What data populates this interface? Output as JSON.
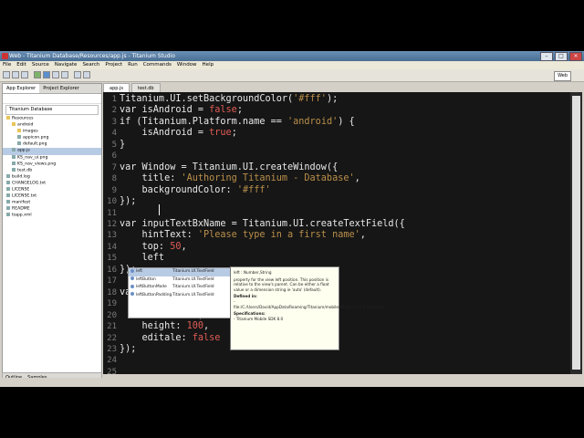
{
  "window": {
    "title": "Web - Titanium Database/Resources/app.js - Titanium Studio",
    "controls": [
      "–",
      "□",
      "×"
    ]
  },
  "menu": [
    "File",
    "Edit",
    "Source",
    "Navigate",
    "Search",
    "Project",
    "Run",
    "Commands",
    "Window",
    "Help"
  ],
  "toolbar": {
    "perspective_label": "Web"
  },
  "left_panel": {
    "tabs": [
      "App Explorer",
      "Project Explorer"
    ],
    "project": "Titanium Database",
    "tree": [
      {
        "label": "Resources",
        "level": 0,
        "folder": true
      },
      {
        "label": "android",
        "level": 1,
        "folder": true
      },
      {
        "label": "images",
        "level": 2,
        "folder": true
      },
      {
        "label": "appicon.png",
        "level": 2,
        "folder": false
      },
      {
        "label": "default.png",
        "level": 2,
        "folder": false
      },
      {
        "label": "app.js",
        "level": 1,
        "folder": false,
        "selected": true
      },
      {
        "label": "KS_nav_ui.png",
        "level": 1,
        "folder": false
      },
      {
        "label": "KS_nav_views.png",
        "level": 1,
        "folder": false
      },
      {
        "label": "test.db",
        "level": 1,
        "folder": false
      },
      {
        "label": "build.log",
        "level": 0,
        "folder": false
      },
      {
        "label": "CHANGELOG.txt",
        "level": 0,
        "folder": false
      },
      {
        "label": "LICENSE",
        "level": 0,
        "folder": false
      },
      {
        "label": "LICENSE.txt",
        "level": 0,
        "folder": false
      },
      {
        "label": "manifest",
        "level": 0,
        "folder": false
      },
      {
        "label": "README",
        "level": 0,
        "folder": false
      },
      {
        "label": "tiapp.xml",
        "level": 0,
        "folder": false
      }
    ],
    "bottom_tabs": [
      "Outline",
      "Samples"
    ]
  },
  "editor": {
    "tabs": [
      "app.js",
      "test.db"
    ],
    "lines": [
      "Titanium.UI.setBackgroundColor('#fff');",
      "var isAndroid = false;",
      "if (Titanium.Platform.name == 'android') {",
      "    isAndroid = true;",
      "}",
      "",
      "var Window = Titanium.UI.createWindow({",
      "    title: 'Authoring Titanium - Database',",
      "    backgroundColor: '#fff'",
      "});",
      "",
      "var inputTextBxName = Titanium.UI.createTextField({",
      "    hintText: 'Please type in a first name',",
      "    top: 50,",
      "    left",
      "});",
      "",
      "var",
      "",
      "    width: 200,",
      "    height: 100,",
      "    editale: false",
      "});",
      "",
      ""
    ],
    "line_numbers": [
      "1",
      "2",
      "3",
      "4",
      "5",
      "6",
      "7",
      "8",
      "9",
      "10",
      "11",
      "12",
      "13",
      "14",
      "15",
      "16",
      "17",
      "18",
      "19",
      "20",
      "21",
      "22",
      "23",
      "24",
      "25"
    ]
  },
  "autocomplete": {
    "items": [
      {
        "name": "left",
        "type": "Titanium.UI.TextField",
        "selected": true
      },
      {
        "name": "leftButton",
        "type": "Titanium.UI.TextField"
      },
      {
        "name": "leftButtonMode",
        "type": "Titanium.UI.TextField"
      },
      {
        "name": "leftButtonPadding",
        "type": "Titanium.UI.TextField"
      }
    ]
  },
  "doc_popup": {
    "signature": "left : Number,String",
    "description": "property for the view left position. This position is relative to the view's parent. Can be either a float value or a dimension string ie 'auto' (default).",
    "defined_label": "Defined in:",
    "defined_path": "- file:/C:/Users/David/AppData/Roaming/Titanium/mobilesdk/win32/1.7.2/api.jsca",
    "spec_label": "Specifications:",
    "spec_value": "- Titanium Mobile SDK 8.0"
  }
}
